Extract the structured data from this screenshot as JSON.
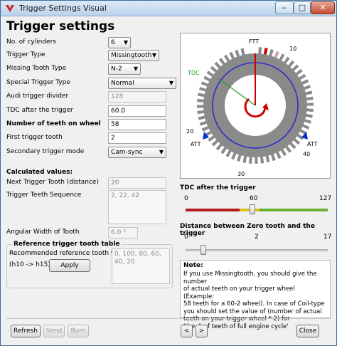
{
  "window": {
    "title": "Trigger Settings Visual",
    "controls": {
      "minimize": "‒",
      "maximize": "□",
      "close": "✕"
    }
  },
  "page_title": "Trigger settings",
  "form": {
    "cylinders": {
      "label": "No. of cylinders",
      "value": "6"
    },
    "trigger_type": {
      "label": "Trigger Type",
      "value": "Missingtooth"
    },
    "missing_tooth_type": {
      "label": "Missing Tooth Type",
      "value": "N-2"
    },
    "special_trigger_type": {
      "label": "Special Trigger Type",
      "value": "Normal"
    },
    "audi_divider": {
      "label": "Audi trigger divider",
      "value": "128"
    },
    "tdc_after": {
      "label": "TDC after the trigger",
      "value": "60.0"
    },
    "num_teeth": {
      "label": "Number of teeth on wheel",
      "value": "58"
    },
    "first_tooth": {
      "label": "First trigger tooth",
      "value": "2"
    },
    "secondary_mode": {
      "label": "Secondary trigger mode",
      "value": "Cam-sync"
    }
  },
  "calculated": {
    "heading": "Calculated values:",
    "next_tooth": {
      "label": "Next Trigger Tooth (distance)",
      "value": "20"
    },
    "sequence": {
      "label": "Trigger Teeth Sequence",
      "value": "2, 22, 42"
    },
    "angular_width": {
      "label": "Angular Width of Tooth",
      "value": "6.0 °"
    }
  },
  "reference": {
    "group_title": "Reference trigger tooth table",
    "recommended_label": "Recommended reference tooth table",
    "range_label": "(h10 -> h15)",
    "apply": "Apply",
    "values": "0, 100, 80, 60,\n40, 20"
  },
  "wheel": {
    "labels": {
      "ftt": "FTT",
      "tdc": "TDC",
      "att_left": "ATT",
      "att_right": "ATT"
    },
    "numbers": [
      "10",
      "20",
      "30",
      "40"
    ],
    "colors": {
      "ring": "#8a8a8a",
      "circle": "#2a2acf",
      "tdc_line": "#1e9e1e",
      "arrow": "#cc0000",
      "att": "#0033cc",
      "ftt": "#cc0000"
    }
  },
  "tdc_slider": {
    "title": "TDC after the trigger",
    "min": "0",
    "mid": "60",
    "max": "127",
    "fraction": 0.472
  },
  "zero_slider": {
    "title": "Distance between Zero tooth and the trigger",
    "min": "0",
    "mid": "2",
    "max": "17",
    "fraction": 0.118
  },
  "note": {
    "title": "Note:",
    "lines": [
      "If you use Missingtooth, you should give the number",
      "of actual teeth on your trigger wheel (Example:",
      "58 teeth for a 60-2 wheel). In case of Coil-type",
      "you should set the value of (number of actual",
      "teeth on your trigger wheel * 2) for",
      "'the # of teeth of full engine cycle'"
    ]
  },
  "buttons": {
    "refresh": "Refresh",
    "send": "Send",
    "burn": "Burn",
    "prev": "<",
    "next": ">",
    "close": "Close"
  }
}
